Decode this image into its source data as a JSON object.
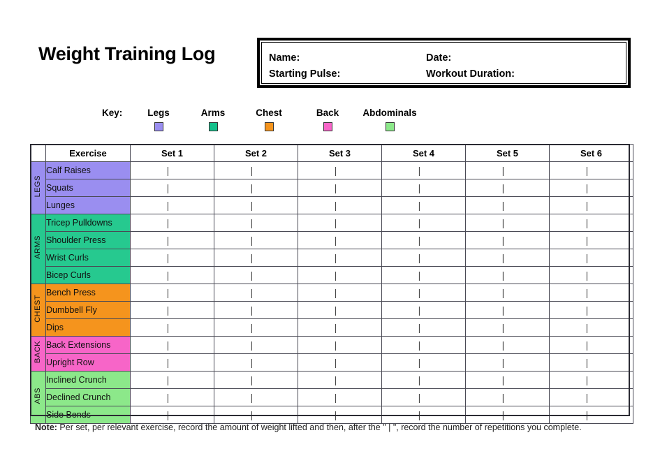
{
  "page": {
    "title": "Weight Training Log"
  },
  "info_box": {
    "name_label": "Name:",
    "pulse_label": "Starting Pulse:",
    "date_label": "Date:",
    "duration_label": "Workout Duration:"
  },
  "key": {
    "label": "Key:",
    "items": [
      {
        "name": "Legs",
        "color": "#9a8ef0"
      },
      {
        "name": "Arms",
        "color": "#14c08b"
      },
      {
        "name": "Chest",
        "color": "#f5941d"
      },
      {
        "name": "Back",
        "color": "#f765c8"
      },
      {
        "name": "Abdominals",
        "color": "#8ce88a"
      }
    ]
  },
  "table": {
    "headers": [
      "Exercise",
      "Set 1",
      "Set 2",
      "Set 3",
      "Set 4",
      "Set 5",
      "Set 6"
    ],
    "tick_mark": "|",
    "groups": [
      {
        "category": "LEGS",
        "color": "#9a8ef0",
        "exercises": [
          "Calf Raises",
          "Squats",
          "Lunges"
        ]
      },
      {
        "category": "ARMS",
        "color": "#26c98f",
        "exercises": [
          "Tricep Pulldowns",
          "Shoulder Press",
          "Wrist Curls",
          "Bicep Curls"
        ]
      },
      {
        "category": "CHEST",
        "color": "#f5941d",
        "exercises": [
          "Bench Press",
          "Dumbbell Fly",
          "Dips"
        ]
      },
      {
        "category": "BACK",
        "color": "#f765c8",
        "exercises": [
          "Back Extensions",
          "Upright Row"
        ]
      },
      {
        "category": "ABS",
        "color": "#8ce88a",
        "exercises": [
          "Inclined Crunch",
          "Declined Crunch",
          "Side Bends"
        ]
      }
    ]
  },
  "note": {
    "prefix": "Note:",
    "text": " Per set, per relevant exercise, record the amount of weight lifted and then, after the \" | \", record the number of repetitions you complete."
  }
}
